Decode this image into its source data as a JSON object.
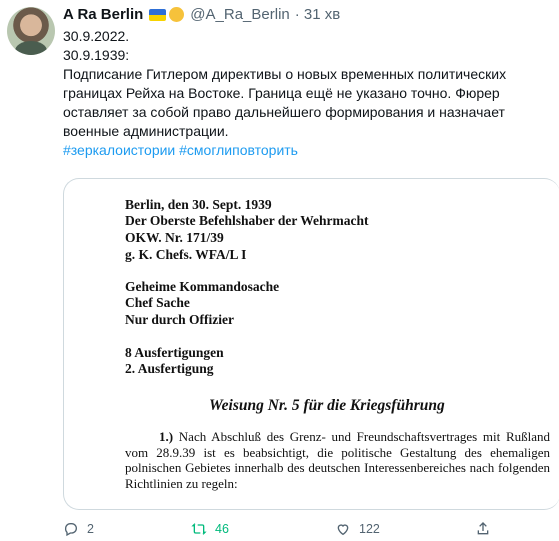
{
  "tweet": {
    "author_name": "A Ra Berlin",
    "handle": "@A_Ra_Berlin",
    "time": "· 31 хв",
    "lines": [
      "30.9.2022.",
      "30.9.1939:",
      "Подписание Гитлером директивы о новых временных политических",
      "границах Рейха на Востоке. Граница ещё не указано точно. Фюрер",
      "оставляет за собой право дальнейшего формирования и назначает",
      "военные администрации."
    ],
    "hashtags": [
      "#зеркалоистории",
      "#смоглиповторить"
    ]
  },
  "document": {
    "header_lines": [
      "Berlin, den 30. Sept. 1939",
      "Der Oberste Befehlshaber der Wehrmacht",
      "OKW. Nr. 171/39",
      "g. K. Chefs. WFA/L I"
    ],
    "secret_lines": [
      "Geheime Kommandosache",
      "Chef Sache",
      "Nur durch Offizier"
    ],
    "copy_lines": [
      "8 Ausfertigungen",
      "2. Ausfertigung"
    ],
    "title": "Weisung Nr. 5 für die Kriegsführung",
    "para_number": "1.)",
    "para_text": "Nach Abschluß des Grenz- und Freundschaftsvertrages mit Rußland vom 28.9.39 ist es beabsichtigt, die politische Gestaltung des ehemaligen polnischen Gebietes innerhalb des deutschen Interessenbereiches nach folgenden Richtlinien zu regeln:"
  },
  "actions": {
    "reply_count": "2",
    "retweet_count": "46",
    "like_count": "122"
  },
  "colors": {
    "accent": "#1d9bf0",
    "retweet": "#00ba7c",
    "muted": "#536471",
    "border": "#cfd9de"
  }
}
